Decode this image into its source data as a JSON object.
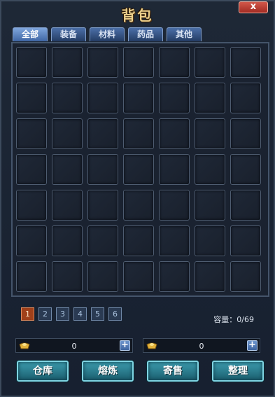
{
  "window": {
    "title": "背包",
    "close_label": "x"
  },
  "tabs": [
    {
      "label": "全部",
      "active": true
    },
    {
      "label": "装备",
      "active": false
    },
    {
      "label": "材料",
      "active": false
    },
    {
      "label": "药品",
      "active": false
    },
    {
      "label": "其他",
      "active": false
    }
  ],
  "grid": {
    "rows": 7,
    "columns": 7,
    "filled": 0
  },
  "pager": {
    "pages": [
      "1",
      "2",
      "3",
      "4",
      "5",
      "6"
    ],
    "current": 1
  },
  "capacity": "容量：0/69",
  "currency": [
    {
      "icon": "gold-ingot-icon",
      "amount": "0"
    },
    {
      "icon": "gold-ingot-icon",
      "amount": "0"
    }
  ],
  "buttons": {
    "warehouse": "仓库",
    "smelt": "熔炼",
    "consign": "寄售",
    "sort": "整理"
  },
  "colors": {
    "accent": "#3c9cae",
    "title": "#ecd08c",
    "active_page": "#a0401a"
  }
}
